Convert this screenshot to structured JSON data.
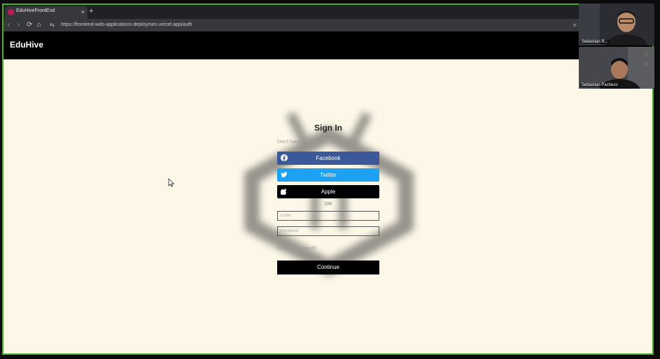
{
  "browser": {
    "tab_title": "EduHiveFrontEnd",
    "tab_close": "×",
    "new_tab": "+",
    "back": "‹",
    "forward": "›",
    "reload": "⟳",
    "home": "⌂",
    "site_settings": "⇆",
    "url": "https://frontend-web-applications-deploymen.vercel.app/auth",
    "share": "<"
  },
  "app": {
    "brand": "EduHive"
  },
  "auth": {
    "title": "Sign In",
    "signup_prompt": "Don't have an account? Sign Up",
    "facebook_label": "Facebook",
    "twitter_label": "Twitter",
    "apple_label": "Apple",
    "or_label": "OR",
    "email_placeholder": "Email",
    "password_placeholder": "Password",
    "forgot_label": "Forgot password?",
    "continue_label": "Continue"
  },
  "colors": {
    "facebook": "#3b5998",
    "twitter": "#1da1f2",
    "apple": "#000000",
    "page_bg": "#fcf7e7",
    "frame_border": "#4caf2a"
  },
  "participants": [
    {
      "name": "Sebastian R..."
    },
    {
      "name": "Sebastian Pacheco"
    }
  ]
}
